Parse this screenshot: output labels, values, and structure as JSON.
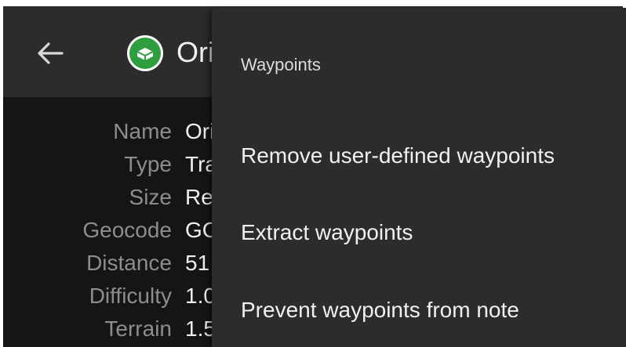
{
  "appbar": {
    "title": "Ori",
    "back_icon": "arrow-left-icon",
    "cache_icon": "traditional-cache-icon"
  },
  "details": [
    {
      "label": "Name",
      "value": "Ori"
    },
    {
      "label": "Type",
      "value": "Tra"
    },
    {
      "label": "Size",
      "value": "Re"
    },
    {
      "label": "Geocode",
      "value": "GC"
    },
    {
      "label": "Distance",
      "value": "51"
    },
    {
      "label": "Difficulty",
      "value": "1.0"
    },
    {
      "label": "Terrain",
      "value": "1.5"
    }
  ],
  "menu": {
    "header": "Waypoints",
    "items": [
      {
        "label": "Remove user-defined waypoints"
      },
      {
        "label": "Extract waypoints"
      },
      {
        "label": "Prevent waypoints from note"
      }
    ]
  },
  "colors": {
    "appbar_bg": "#2c2c2c",
    "content_bg": "#151515",
    "menu_bg": "#2c2c2c",
    "cache_icon_green": "#2f9e3e",
    "label_gray": "#8d8d8d",
    "text_light": "#f0f0f0"
  }
}
